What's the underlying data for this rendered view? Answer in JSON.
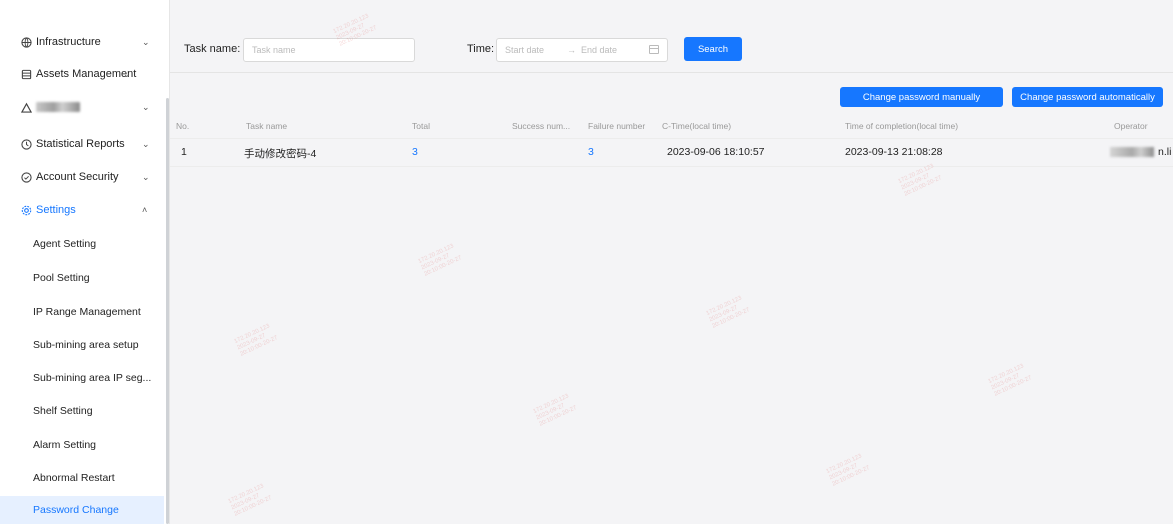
{
  "sidebar": {
    "menu": [
      {
        "label": "Infrastructure",
        "icon": "globe-icon"
      },
      {
        "label": "Assets Management",
        "icon": "database-icon"
      },
      {
        "label": "",
        "icon": "chart-icon",
        "redacted": true
      },
      {
        "label": "Statistical Reports",
        "icon": "clock-icon"
      },
      {
        "label": "Account Security",
        "icon": "shield-icon"
      },
      {
        "label": "Settings",
        "icon": "gear-icon"
      }
    ],
    "settings_items": [
      {
        "label": "Agent Setting"
      },
      {
        "label": "Pool Setting"
      },
      {
        "label": "IP Range Management"
      },
      {
        "label": "Sub-mining area setup"
      },
      {
        "label": "Sub-mining area IP seg..."
      },
      {
        "label": "Shelf Setting"
      },
      {
        "label": "Alarm Setting"
      },
      {
        "label": "Abnormal Restart"
      },
      {
        "label": "Password Change"
      }
    ],
    "selected": "Password Change"
  },
  "filters": {
    "task_name_label": "Task name:",
    "task_name_placeholder": "Task name",
    "time_label": "Time:",
    "start_placeholder": "Start date",
    "range_separator": "→",
    "end_placeholder": "End date",
    "search_label": "Search"
  },
  "actions": {
    "manual_label": "Change password manually",
    "auto_label": "Change password automatically"
  },
  "table": {
    "columns": [
      "No.",
      "Task name",
      "Total",
      "Success num...",
      "Failure number",
      "C-Time(local time)",
      "Time of completion(local time)",
      "Operator"
    ],
    "rows": [
      {
        "no": "1",
        "task_name": "手动修改密码-4",
        "total": "3",
        "success": "",
        "failure": "3",
        "ctime": "2023-09-06 18:10:57",
        "completion": "2023-09-13 21:08:28",
        "operator_suffix": "n.li"
      }
    ]
  },
  "colors": {
    "accent": "#1677ff",
    "selected_bg": "#e6f0ff",
    "page_bg": "#f4f4f6"
  }
}
